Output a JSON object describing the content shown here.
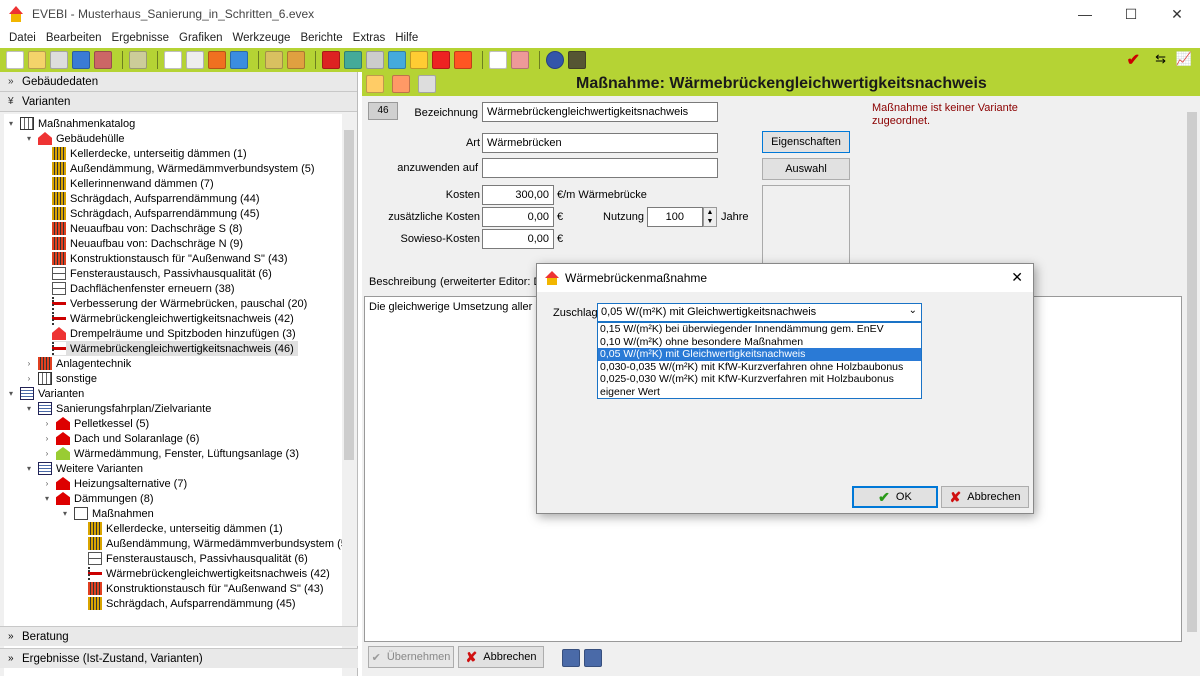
{
  "window": {
    "title": "EVEBI - Musterhaus_Sanierung_in_Schritten_6.evex",
    "minimize": "—",
    "maximize": "☐",
    "close": "✕"
  },
  "menu": [
    "Datei",
    "Bearbeiten",
    "Ergebnisse",
    "Grafiken",
    "Werkzeuge",
    "Berichte",
    "Extras",
    "Hilfe"
  ],
  "sidebar": {
    "sections": {
      "gebaeudedaten": "Gebäudedaten",
      "varianten": "Varianten",
      "beratung": "Beratung",
      "ergebnisse": "Ergebnisse (Ist-Zustand, Varianten)"
    },
    "tree": [
      "Maßnahmenkatalog",
      "Gebäudehülle",
      "Kellerdecke, unterseitig dämmen (1)",
      "Außendämmung, Wärmedämmverbundsystem (5)",
      "Kellerinnenwand dämmen (7)",
      "Schrägdach, Aufsparrendämmung (44)",
      "Schrägdach, Aufsparrendämmung (45)",
      "Neuaufbau von: Dachschräge S (8)",
      "Neuaufbau von: Dachschräge N (9)",
      "Konstruktionstausch für \"Außenwand S\" (43)",
      "Fensteraustausch, Passivhausqualität (6)",
      "Dachflächenfenster erneuern (38)",
      "Verbesserung der Wärmebrücken, pauschal (20)",
      "Wärmebrückengleichwertigkeitsnachweis (42)",
      "Drempelräume und Spitzboden hinzufügen (3)",
      "Wärmebrückengleichwertigkeitsnachweis (46)",
      "Anlagentechnik",
      "sonstige",
      "Varianten",
      "Sanierungsfahrplan/Zielvariante",
      "Pelletkessel (5)",
      "Dach und Solaranlage (6)",
      "Wärmedämmung, Fenster, Lüftungsanlage (3)",
      "Weitere Varianten",
      "Heizungsalternative (7)",
      "Dämmungen (8)",
      "Maßnahmen",
      "Kellerdecke, unterseitig dämmen (1)",
      "Außendämmung, Wärmedämmverbundsystem (5)",
      "Fensteraustausch, Passivhausqualität (6)",
      "Wärmebrückengleichwertigkeitsnachweis (42)",
      "Konstruktionstausch für \"Außenwand S\" (43)",
      "Schrägdach, Aufsparrendämmung (45)"
    ]
  },
  "main": {
    "title": "Maßnahme: Wärmebrückengleichwertigkeitsnachweis",
    "number": "46",
    "labels": {
      "bezeichnung": "Bezeichnung",
      "art": "Art",
      "anzuwenden": "anzuwenden auf",
      "kosten": "Kosten",
      "zus_kosten": "zusätzliche Kosten",
      "nutzung": "Nutzung",
      "sowieso": "Sowieso-Kosten",
      "beschreibung": "Beschreibung",
      "editor": "(erweiterter Editor: D"
    },
    "values": {
      "bezeichnung": "Wärmebrückengleichwertigkeitsnachweis",
      "art": "Wärmebrücken",
      "anzuwenden": "",
      "kosten": "300,00",
      "zus_kosten": "0,00",
      "nutzung": "100",
      "sowieso": "0,00"
    },
    "units": {
      "kosten": "€/m Wärmebrücke",
      "zus_kosten": "€",
      "nutzung": "Jahre",
      "sowieso": "€"
    },
    "buttons": {
      "eigenschaften": "Eigenschaften",
      "auswahl": "Auswahl",
      "uebernehmen": "Übernehmen",
      "abbrechen": "Abbrechen"
    },
    "notice": "Maßnahme ist keiner Variante zugeordnet.",
    "description": "Die gleichwerige Umsetzung aller im B"
  },
  "dialog": {
    "title": "Wärmebrückenmaßnahme",
    "zuschlag_label": "Zuschlag",
    "selected": "0,05 W/(m²K) mit Gleichwertigkeitsnachweis",
    "options": [
      "0,15 W/(m²K) bei überwiegender Innendämmung gem. EnEV",
      "0,10 W/(m²K) ohne besondere Maßnahmen",
      "0,05 W/(m²K) mit Gleichwertigkeitsnachweis",
      "0,030-0,035 W/(m²K) mit KfW-Kurzverfahren ohne Holzbaubonus",
      "0,025-0,030 W/(m²K) mit KfW-Kurzverfahren mit Holzbaubonus",
      "eigener Wert"
    ],
    "ok": "OK",
    "cancel": "Abbrechen"
  },
  "colors": {
    "toolbar": "#b5d334",
    "notice": "#8b0000",
    "selection": "#2a7ad6"
  }
}
